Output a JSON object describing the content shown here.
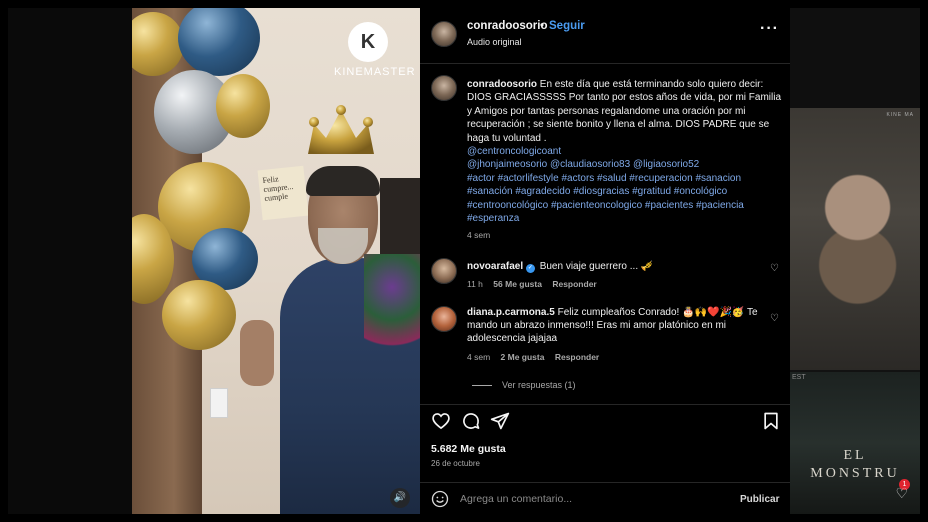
{
  "post": {
    "username": "conradoosorio",
    "separator": "•",
    "follow_label": "Seguir",
    "audio_label": "Audio original",
    "more_icon": "more-horizontal-icon"
  },
  "media": {
    "watermark_brand": "KINEMASTER",
    "watermark_logo_letter": "K",
    "note_text": "Feliz cumpre... cumple",
    "mute_icon": "speaker-icon"
  },
  "caption": {
    "username": "conradoosorio",
    "text": "En este día que está terminando solo quiero decir: DIOS GRACIASSSSS Por tanto por estos años de vida, por mi Familia y Amigos por tantas personas regalandome una oración por mi recuperación ; se siente bonito y llena el alma. DIOS PADRE que se haga tu voluntad .",
    "mentions_1": "@centroncologicoant",
    "mentions_2": "@jhonjaimeosorio @claudiaosorio83 @ligiaosorio52",
    "hashtags": "#actor #actorlifestyle #actors #salud #recuperacion #sanacion #sanación #agradecido #diosgracias #gratitud #oncológico #centrooncológico #pacienteoncologico #pacientes #paciencia #esperanza",
    "time": "4 sem"
  },
  "comments": [
    {
      "username": "novoarafael",
      "verified": true,
      "text": "Buen viaje guerrero ... 🎺",
      "time": "11 h",
      "likes": "56 Me gusta",
      "reply_label": "Responder"
    },
    {
      "username": "diana.p.carmona.5",
      "verified": false,
      "text": "Feliz cumpleaños Conrado! 🎂🙌❤️🎉🥳 Te mando un abrazo inmenso!!! Eras mi amor platónico en mi adolescencia jajajaa",
      "time": "4 sem",
      "likes": "2 Me gusta",
      "reply_label": "Responder"
    }
  ],
  "view_replies": "Ver respuestas (1)",
  "actions": {
    "like_count": "5.682 Me gusta",
    "date": "26 de octubre"
  },
  "composer": {
    "placeholder": "Agrega un comentario...",
    "publish_label": "Publicar"
  },
  "side": {
    "poster_tag": "EST",
    "poster_title_1": "EL",
    "poster_title_2": "MONSTRU",
    "notification_count": "1",
    "portrait_tag": "KINE MA"
  },
  "colors": {
    "link": "#7fa9e8",
    "follow": "#4a9bf0",
    "verified": "#3897f0",
    "panel_bg": "#000000"
  }
}
